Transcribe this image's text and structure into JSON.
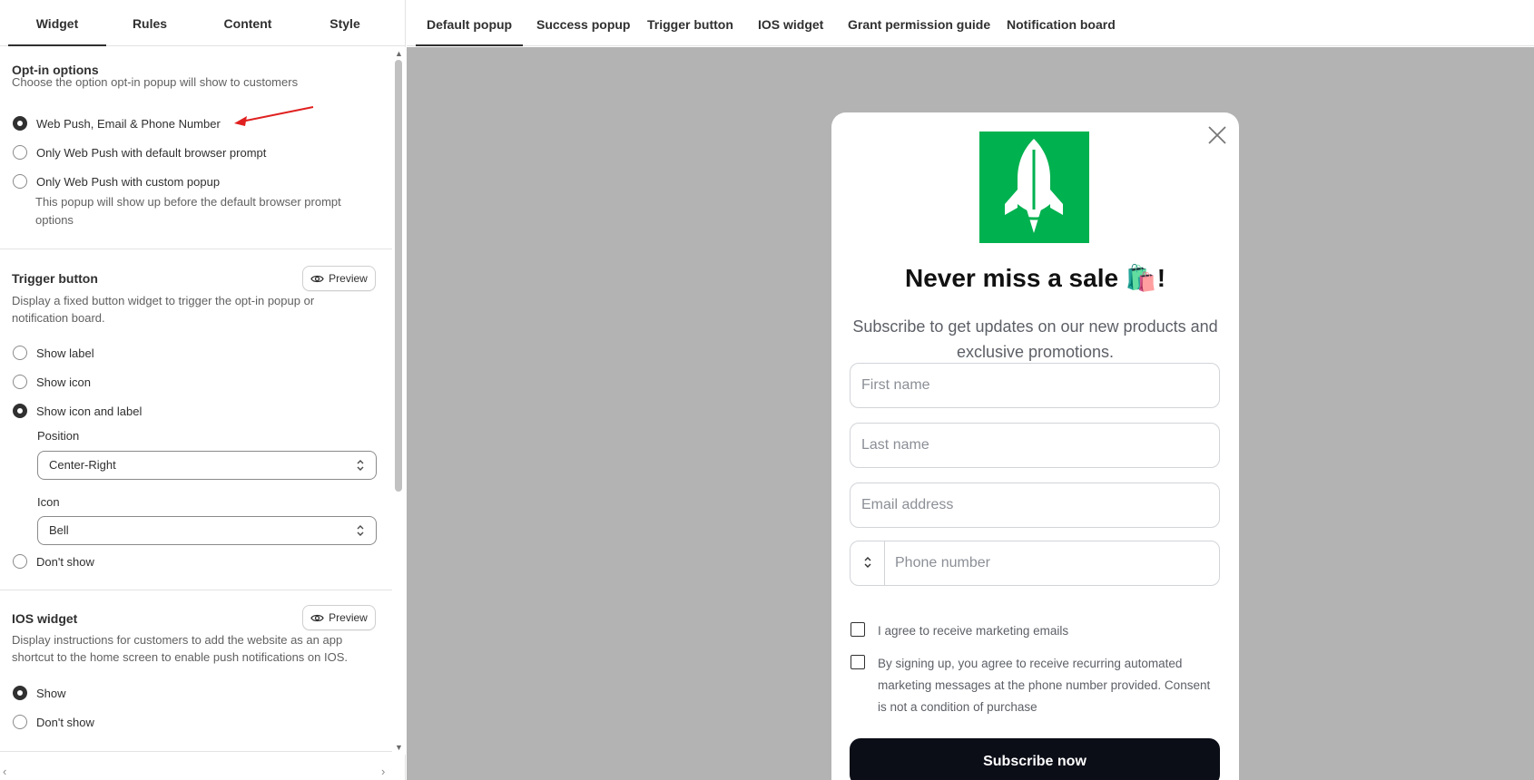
{
  "left_tabs": [
    "Widget",
    "Rules",
    "Content",
    "Style"
  ],
  "optin": {
    "title": "Opt-in options",
    "desc": "Choose the option opt-in popup will show to customers",
    "options": [
      {
        "label": "Web Push, Email & Phone Number",
        "checked": true
      },
      {
        "label": "Only Web Push with default browser prompt",
        "checked": false
      },
      {
        "label": "Only Web Push with custom popup",
        "checked": false
      }
    ],
    "custom_note_1": "This popup will show up before the default browser prompt",
    "custom_note_2": "options"
  },
  "trigger": {
    "title": "Trigger button",
    "preview_label": "Preview",
    "desc_1": "Display a fixed button widget to trigger the opt-in popup or",
    "desc_2": "notification board.",
    "options": [
      {
        "label": "Show label",
        "checked": false
      },
      {
        "label": "Show icon",
        "checked": false
      },
      {
        "label": "Show icon and label",
        "checked": true
      },
      {
        "label": "Don't show",
        "checked": false
      }
    ],
    "position_label": "Position",
    "position_value": "Center-Right",
    "icon_label": "Icon",
    "icon_value": "Bell"
  },
  "ios": {
    "title": "IOS widget",
    "preview_label": "Preview",
    "desc_1": "Display instructions for customers to add the website as an app",
    "desc_2": "shortcut to the home screen to enable push notifications on IOS.",
    "options": [
      {
        "label": "Show",
        "checked": true
      },
      {
        "label": "Don't show",
        "checked": false
      }
    ]
  },
  "right_tabs": [
    "Default popup",
    "Success popup",
    "Trigger button",
    "IOS widget",
    "Grant permission guide",
    "Notification board"
  ],
  "popup": {
    "title": "Never miss a sale 🛍️!",
    "subtitle": "Subscribe to get updates on our new products and exclusive promotions.",
    "first_name_ph": "First name",
    "last_name_ph": "Last name",
    "email_ph": "Email address",
    "phone_ph": "Phone number",
    "agree_emails": "I agree to receive marketing emails",
    "agree_sms": "By signing up, you agree to receive recurring automated marketing messages at the phone number provided. Consent is not a condition of purchase",
    "subscribe_label": "Subscribe now",
    "logo_color": "#00b14f"
  },
  "annotation_arrow_color": "#e02020"
}
